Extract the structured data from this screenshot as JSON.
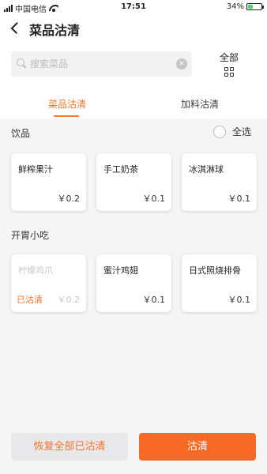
{
  "status_bar": {
    "carrier": "中国电信",
    "time": "17:51",
    "battery": "34%"
  },
  "header": {
    "title": "菜品沽清"
  },
  "search": {
    "placeholder": "搜索菜品",
    "clear": "×"
  },
  "all_button": {
    "label": "全部"
  },
  "tabs": [
    {
      "label": "菜品沽清",
      "active": true
    },
    {
      "label": "加料沽清",
      "active": false
    }
  ],
  "sections": [
    {
      "title": "饮品",
      "select_all_label": "全选",
      "items": [
        {
          "name": "鲜榨果汁",
          "price": "￥0.2",
          "status": ""
        },
        {
          "name": "手工奶茶",
          "price": "￥0.1",
          "status": ""
        },
        {
          "name": "冰淇淋球",
          "price": "￥0.1",
          "status": ""
        }
      ]
    },
    {
      "title": "开胃小吃",
      "items": [
        {
          "name": "柠檬鸡爪",
          "price": "￥0.2",
          "status": "已沽清"
        },
        {
          "name": "蜜汁鸡翅",
          "price": "￥0.1",
          "status": ""
        },
        {
          "name": "日式照烧排骨",
          "price": "￥0.1",
          "status": ""
        }
      ]
    }
  ],
  "footer": {
    "restore_label": "恢复全部已沽清",
    "clear_label": "沽清"
  },
  "colors": {
    "accent": "#f5742a",
    "button_primary": "#f76a26",
    "battery_fill": "#4cd964"
  }
}
